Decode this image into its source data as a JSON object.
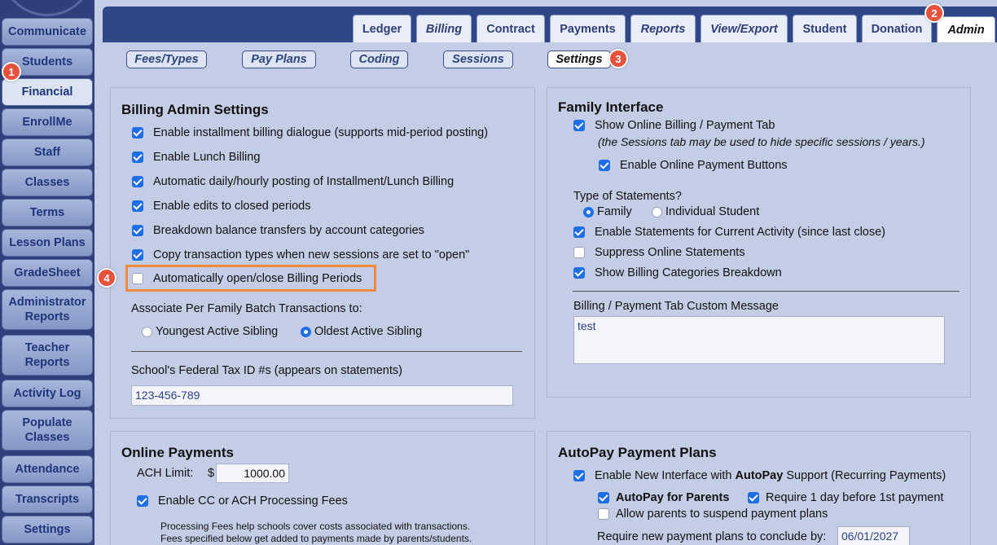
{
  "sidebar": {
    "items": [
      {
        "label": "Communicate"
      },
      {
        "label": "Students"
      },
      {
        "label": "Financial"
      },
      {
        "label": "EnrollMe"
      },
      {
        "label": "Staff"
      },
      {
        "label": "Classes"
      },
      {
        "label": "Terms"
      },
      {
        "label": "Lesson Plans"
      },
      {
        "label": "GradeSheet"
      },
      {
        "label": "Administrator Reports"
      },
      {
        "label": "Teacher Reports"
      },
      {
        "label": "Activity Log"
      },
      {
        "label": "Populate Classes"
      },
      {
        "label": "Attendance"
      },
      {
        "label": "Transcripts"
      },
      {
        "label": "Settings"
      }
    ]
  },
  "tabs": [
    "Ledger",
    "Billing",
    "Contract",
    "Payments",
    "Reports",
    "View/Export",
    "Student",
    "Donation",
    "Admin"
  ],
  "subtabs": [
    "Fees/Types",
    "Pay Plans",
    "Coding",
    "Sessions",
    "Settings"
  ],
  "badges": [
    "1",
    "2",
    "3",
    "4"
  ],
  "billing_admin": {
    "title": "Billing Admin Settings",
    "options": [
      "Enable installment billing dialogue (supports mid-period posting)",
      "Enable Lunch Billing",
      "Automatic daily/hourly posting of Installment/Lunch Billing",
      "Enable edits to closed periods",
      "Breakdown balance transfers by account categories",
      "Copy transaction types when new sessions are set to \"open\"",
      "Automatically open/close Billing Periods"
    ],
    "associate_label": "Associate Per Family Batch Transactions to:",
    "radio_youngest": "Youngest Active Sibling",
    "radio_oldest": "Oldest Active Sibling",
    "tax_label": "School's Federal Tax ID #s (appears on statements)",
    "tax_value": "123-456-789"
  },
  "family_interface": {
    "title": "Family Interface",
    "show_online": "Show Online Billing / Payment Tab",
    "show_online_note": "(the Sessions tab may be used to hide specific sessions / years.)",
    "enable_online_buttons": "Enable Online Payment Buttons",
    "statements_type_label": "Type of Statements?",
    "radio_family": "Family",
    "radio_individual": "Individual Student",
    "enable_statements": "Enable Statements for Current Activity (since last close)",
    "suppress_online": "Suppress Online Statements",
    "show_categories": "Show Billing Categories Breakdown",
    "custom_message_label": "Billing / Payment Tab Custom Message",
    "custom_message_value": "test"
  },
  "online_payments": {
    "title": "Online Payments",
    "ach_label": "ACH Limit:",
    "ach_currency": "$",
    "ach_value": "1000.00",
    "enable_fees": "Enable CC or ACH Processing Fees",
    "fees_note_1": "Processing Fees help schools cover costs associated with transactions.",
    "fees_note_2": "Fees specified below get added to payments made by parents/students."
  },
  "autopay": {
    "title": "AutoPay Payment Plans",
    "enable_new_prefix": "Enable New Interface with ",
    "enable_new_bold": "AutoPay",
    "enable_new_suffix": " Support (Recurring Payments)",
    "autopay_parents": "AutoPay for Parents",
    "require_one_day": "Require 1 day before 1st payment",
    "allow_suspend": "Allow parents to suspend payment plans",
    "conclude_label": "Require new payment plans to conclude by:",
    "conclude_value": "06/01/2027"
  }
}
